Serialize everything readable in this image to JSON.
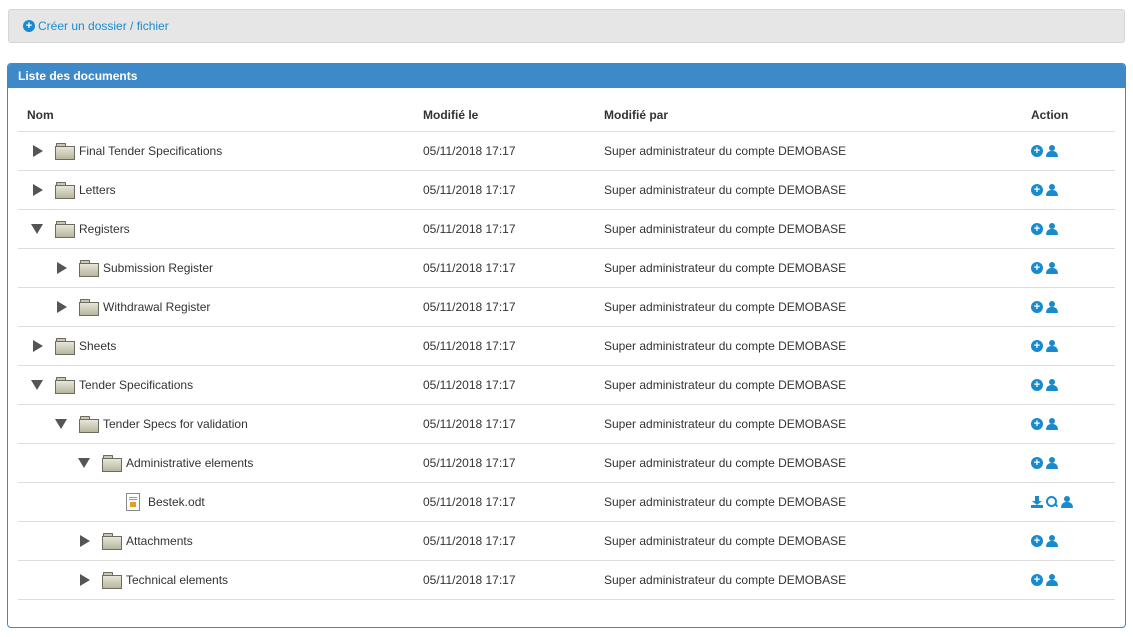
{
  "toolbar": {
    "create_label": "Créer un dossier / fichier"
  },
  "panel": {
    "title": "Liste des documents"
  },
  "table": {
    "headers": {
      "name": "Nom",
      "modified_on": "Modifié le",
      "modified_by": "Modifié par",
      "action": "Action"
    },
    "rows": [
      {
        "name": "Final Tender Specifications",
        "type": "folder",
        "level": 0,
        "state": "collapsed",
        "modified_on": "05/11/2018 17:17",
        "modified_by": "Super administrateur du compte DEMOBASE",
        "actions": [
          "plus-icon",
          "user-icon"
        ]
      },
      {
        "name": "Letters",
        "type": "folder",
        "level": 0,
        "state": "collapsed",
        "modified_on": "05/11/2018 17:17",
        "modified_by": "Super administrateur du compte DEMOBASE",
        "actions": [
          "plus-icon",
          "user-icon"
        ]
      },
      {
        "name": "Registers",
        "type": "folder",
        "level": 0,
        "state": "expanded",
        "modified_on": "05/11/2018 17:17",
        "modified_by": "Super administrateur du compte DEMOBASE",
        "actions": [
          "plus-icon",
          "user-icon"
        ]
      },
      {
        "name": "Submission Register",
        "type": "folder",
        "level": 1,
        "state": "collapsed",
        "modified_on": "05/11/2018 17:17",
        "modified_by": "Super administrateur du compte DEMOBASE",
        "actions": [
          "plus-icon",
          "user-icon"
        ]
      },
      {
        "name": "Withdrawal Register",
        "type": "folder",
        "level": 1,
        "state": "collapsed",
        "modified_on": "05/11/2018 17:17",
        "modified_by": "Super administrateur du compte DEMOBASE",
        "actions": [
          "plus-icon",
          "user-icon"
        ]
      },
      {
        "name": "Sheets",
        "type": "folder",
        "level": 0,
        "state": "collapsed",
        "modified_on": "05/11/2018 17:17",
        "modified_by": "Super administrateur du compte DEMOBASE",
        "actions": [
          "plus-icon",
          "user-icon"
        ]
      },
      {
        "name": "Tender Specifications",
        "type": "folder",
        "level": 0,
        "state": "expanded",
        "modified_on": "05/11/2018 17:17",
        "modified_by": "Super administrateur du compte DEMOBASE",
        "actions": [
          "plus-icon",
          "user-icon"
        ]
      },
      {
        "name": "Tender Specs for validation",
        "type": "folder",
        "level": 1,
        "state": "expanded",
        "modified_on": "05/11/2018 17:17",
        "modified_by": "Super administrateur du compte DEMOBASE",
        "actions": [
          "plus-icon",
          "user-icon"
        ]
      },
      {
        "name": "Administrative elements",
        "type": "folder",
        "level": 2,
        "state": "expanded",
        "modified_on": "05/11/2018 17:17",
        "modified_by": "Super administrateur du compte DEMOBASE",
        "actions": [
          "plus-icon",
          "user-icon"
        ]
      },
      {
        "name": "Bestek.odt",
        "type": "file",
        "level": 3,
        "state": "none",
        "modified_on": "05/11/2018 17:17",
        "modified_by": "Super administrateur du compte DEMOBASE",
        "actions": [
          "download-icon",
          "zoom-icon",
          "user-icon"
        ]
      },
      {
        "name": "Attachments",
        "type": "folder",
        "level": 2,
        "state": "collapsed",
        "modified_on": "05/11/2018 17:17",
        "modified_by": "Super administrateur du compte DEMOBASE",
        "actions": [
          "plus-icon",
          "user-icon"
        ]
      },
      {
        "name": "Technical elements",
        "type": "folder",
        "level": 2,
        "state": "collapsed",
        "modified_on": "05/11/2018 17:17",
        "modified_by": "Super administrateur du compte DEMOBASE",
        "actions": [
          "plus-icon",
          "user-icon"
        ]
      }
    ]
  },
  "colors": {
    "accent": "#1a8acf",
    "panel_header": "#3e8ac8",
    "toolbar_bg": "#e6e6e6"
  }
}
